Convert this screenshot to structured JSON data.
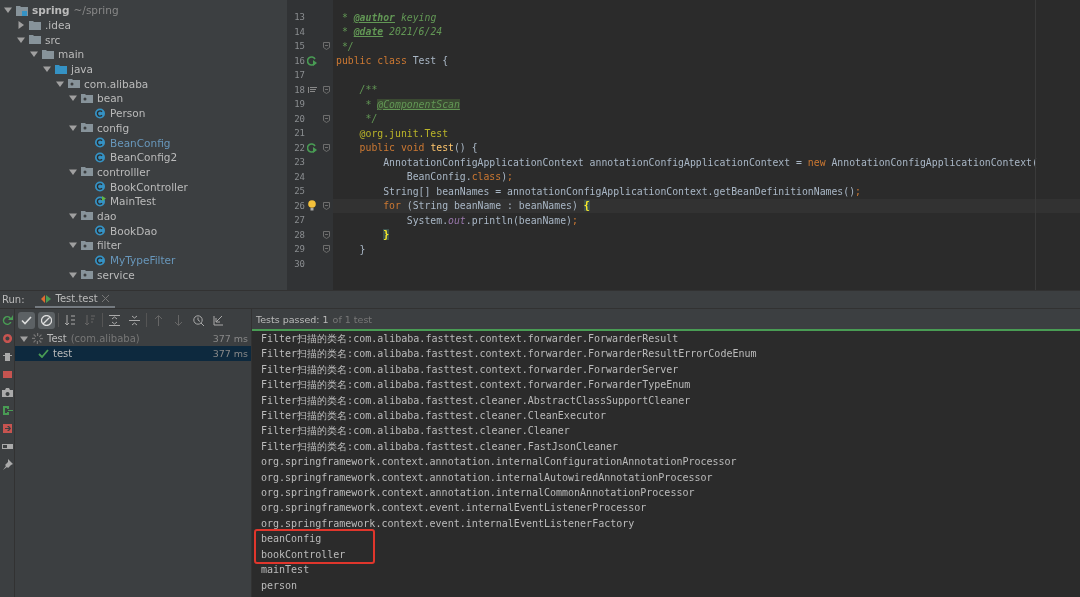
{
  "project_tree": {
    "name": "spring",
    "kind": "project",
    "hint": "~/spring",
    "expanded": true,
    "children": [
      {
        "name": ".idea",
        "kind": "folder",
        "expanded": false
      },
      {
        "name": "src",
        "kind": "folder",
        "expanded": true,
        "children": [
          {
            "name": "main",
            "kind": "folder",
            "expanded": true,
            "children": [
              {
                "name": "java",
                "kind": "source-folder",
                "expanded": true,
                "children": [
                  {
                    "name": "com.alibaba",
                    "kind": "package",
                    "expanded": true,
                    "children": [
                      {
                        "name": "bean",
                        "kind": "package",
                        "expanded": true,
                        "children": [
                          {
                            "name": "Person",
                            "kind": "class",
                            "modified": false
                          }
                        ]
                      },
                      {
                        "name": "config",
                        "kind": "package",
                        "expanded": true,
                        "children": [
                          {
                            "name": "BeanConfig",
                            "kind": "class",
                            "modified": true
                          },
                          {
                            "name": "BeanConfig2",
                            "kind": "class",
                            "modified": false
                          }
                        ]
                      },
                      {
                        "name": "controlller",
                        "kind": "package",
                        "expanded": true,
                        "children": [
                          {
                            "name": "BookController",
                            "kind": "class",
                            "modified": false
                          },
                          {
                            "name": "MainTest",
                            "kind": "main-class",
                            "modified": false
                          }
                        ]
                      },
                      {
                        "name": "dao",
                        "kind": "package",
                        "expanded": true,
                        "children": [
                          {
                            "name": "BookDao",
                            "kind": "class",
                            "modified": false
                          }
                        ]
                      },
                      {
                        "name": "filter",
                        "kind": "package",
                        "expanded": true,
                        "children": [
                          {
                            "name": "MyTypeFilter",
                            "kind": "class",
                            "modified": true
                          }
                        ]
                      },
                      {
                        "name": "service",
                        "kind": "package",
                        "expanded": true
                      }
                    ]
                  }
                ]
              }
            ]
          }
        ]
      }
    ]
  },
  "editor": {
    "lines": [
      {
        "number": "13",
        "tokens": [
          {
            "text": " * ",
            "kind": "doc"
          },
          {
            "text": "@author",
            "kind": "doctag"
          },
          {
            "text": " keying",
            "kind": "doc"
          }
        ]
      },
      {
        "number": "14",
        "tokens": [
          {
            "text": " * ",
            "kind": "doc"
          },
          {
            "text": "@date",
            "kind": "doctag"
          },
          {
            "text": " 2021/6/24",
            "kind": "doc"
          }
        ]
      },
      {
        "number": "15",
        "fold": true,
        "tokens": [
          {
            "text": " */",
            "kind": "doc"
          }
        ]
      },
      {
        "number": "16",
        "kind": "run",
        "tokens": [
          {
            "text": "public class",
            "kind": "keyword"
          },
          {
            "text": " Test {",
            "kind": "plain"
          }
        ]
      },
      {
        "number": "17"
      },
      {
        "number": "18",
        "kind": "doc",
        "fold": true,
        "tokens": [
          {
            "text": "    /**",
            "kind": "doc"
          }
        ]
      },
      {
        "number": "19",
        "tokens": [
          {
            "text": "     * ",
            "kind": "doc"
          },
          {
            "text": "@ComponentScan",
            "kind": "doclink"
          }
        ]
      },
      {
        "number": "20",
        "fold": true,
        "tokens": [
          {
            "text": "     */",
            "kind": "doc"
          }
        ]
      },
      {
        "number": "21",
        "tokens": [
          {
            "text": "    @org.junit.Test",
            "kind": "annotation"
          }
        ]
      },
      {
        "number": "22",
        "kind": "run",
        "fold": true,
        "tokens": [
          {
            "text": "    public void ",
            "kind": "keyword"
          },
          {
            "text": "test",
            "kind": "method"
          },
          {
            "text": "() {",
            "kind": "plain"
          }
        ]
      },
      {
        "number": "23",
        "tokens": [
          {
            "text": "        AnnotationConfigApplicationContext annotationConfigApplicationContext = ",
            "kind": "plain"
          },
          {
            "text": "new",
            "kind": "keyword"
          },
          {
            "text": " AnnotationConfigApplicationContext(",
            "kind": "plain"
          }
        ]
      },
      {
        "number": "24",
        "tokens": [
          {
            "text": "            BeanConfig.",
            "kind": "plain"
          },
          {
            "text": "class",
            "kind": "keyword"
          },
          {
            "text": ")",
            "kind": "plain"
          },
          {
            "text": ";",
            "kind": "keyword"
          }
        ]
      },
      {
        "number": "25",
        "tokens": [
          {
            "text": "        String[] beanNames = annotationConfigApplicationContext.getBeanDefinitionNames()",
            "kind": "plain"
          },
          {
            "text": ";",
            "kind": "keyword"
          }
        ]
      },
      {
        "number": "26",
        "kind": "bulb",
        "fold": true,
        "current": true,
        "tokens": [
          {
            "text": "        for",
            "kind": "keyword"
          },
          {
            "text": " (String beanName : beanNames) ",
            "kind": "plain"
          },
          {
            "text": "{",
            "kind": "brace"
          }
        ]
      },
      {
        "number": "27",
        "tokens": [
          {
            "text": "            System.",
            "kind": "plain"
          },
          {
            "text": "out",
            "kind": "static"
          },
          {
            "text": ".println(beanName)",
            "kind": "plain"
          },
          {
            "text": ";",
            "kind": "keyword"
          }
        ]
      },
      {
        "number": "28",
        "fold": true,
        "tokens": [
          {
            "text": "        }",
            "kind": "brace"
          }
        ]
      },
      {
        "number": "29",
        "fold": true,
        "tokens": [
          {
            "text": "    }",
            "kind": "plain"
          }
        ]
      },
      {
        "number": "30"
      }
    ]
  },
  "run_panel": {
    "label": "Run:",
    "tab": {
      "title": "Test.test",
      "selected": true
    },
    "filters": [
      {
        "on": true
      },
      {
        "on": true
      }
    ],
    "tests": [
      {
        "name": "Test",
        "package": "(com.alibaba)",
        "time": "377 ms",
        "expanded": true,
        "selected": false,
        "passed": true,
        "children": [
          {
            "name": "test",
            "time": "377 ms",
            "selected": true,
            "passed": true
          }
        ]
      }
    ],
    "status": {
      "prefix": "Tests passed: 1",
      "suffix": "of 1 test"
    },
    "console": [
      {
        "text": "Filter扫描的类名:com.alibaba.fasttest.context.forwarder.ForwarderResult",
        "highlighted": false
      },
      {
        "text": "Filter扫描的类名:com.alibaba.fasttest.context.forwarder.ForwarderResultErrorCodeEnum",
        "highlighted": false
      },
      {
        "text": "Filter扫描的类名:com.alibaba.fasttest.context.forwarder.ForwarderServer",
        "highlighted": false
      },
      {
        "text": "Filter扫描的类名:com.alibaba.fasttest.context.forwarder.ForwarderTypeEnum",
        "highlighted": false
      },
      {
        "text": "Filter扫描的类名:com.alibaba.fasttest.cleaner.AbstractClassSupportCleaner",
        "highlighted": false
      },
      {
        "text": "Filter扫描的类名:com.alibaba.fasttest.cleaner.CleanExecutor",
        "highlighted": false
      },
      {
        "text": "Filter扫描的类名:com.alibaba.fasttest.cleaner.Cleaner",
        "highlighted": false
      },
      {
        "text": "Filter扫描的类名:com.alibaba.fasttest.cleaner.FastJsonCleaner",
        "highlighted": false
      },
      {
        "text": "org.springframework.context.annotation.internalConfigurationAnnotationProcessor",
        "highlighted": false
      },
      {
        "text": "org.springframework.context.annotation.internalAutowiredAnnotationProcessor",
        "highlighted": false
      },
      {
        "text": "org.springframework.context.annotation.internalCommonAnnotationProcessor",
        "highlighted": false
      },
      {
        "text": "org.springframework.context.event.internalEventListenerProcessor",
        "highlighted": false
      },
      {
        "text": "org.springframework.context.event.internalEventListenerFactory",
        "highlighted": false
      },
      {
        "text": "beanConfig",
        "highlighted": true
      },
      {
        "text": "bookController",
        "highlighted": true
      },
      {
        "text": "mainTest",
        "highlighted": false
      },
      {
        "text": "person",
        "highlighted": false
      }
    ]
  }
}
